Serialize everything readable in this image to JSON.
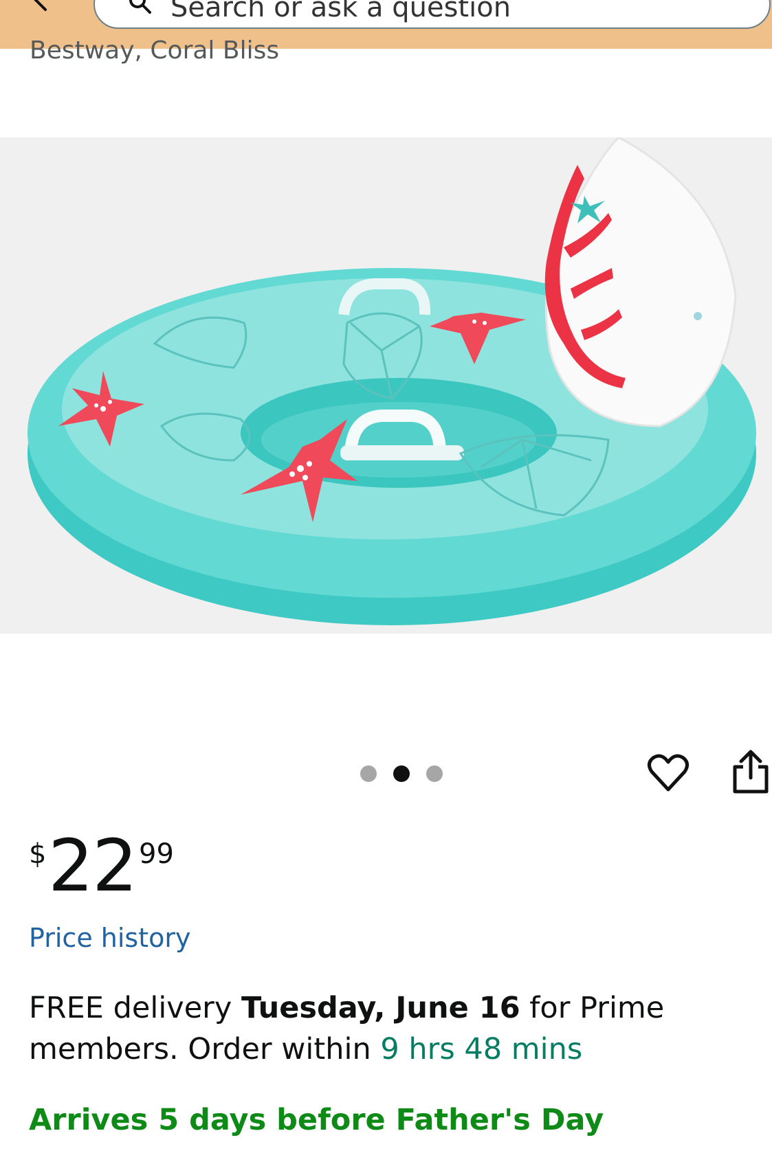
{
  "header": {
    "search_placeholder": "Search or ask a question",
    "background_color": "#f0c08a",
    "icons": [
      "back-arrow-icon",
      "search-icon",
      "camera-icon",
      "microphone-icon"
    ]
  },
  "product": {
    "subtitle": "Bestway, Coral Bliss",
    "image_alt_icon": "inflatable-pool-float-image"
  },
  "carousel": {
    "total": 3,
    "active_index": 1
  },
  "actions": {
    "icons": [
      "heart-icon",
      "share-icon"
    ]
  },
  "price": {
    "currency": "$",
    "whole": "22",
    "fraction": "99"
  },
  "price_history_label": "Price history",
  "delivery": {
    "prefix": "FREE delivery ",
    "date": "Tuesday, June 16",
    "middle": " for Prime members. Order within ",
    "countdown": "9 hrs 48 mins"
  },
  "arrives_label": "Arrives 5 days before Father's Day",
  "colors": {
    "link": "#2162a1",
    "countdown": "#067d62",
    "arrives": "#0e8a16"
  }
}
